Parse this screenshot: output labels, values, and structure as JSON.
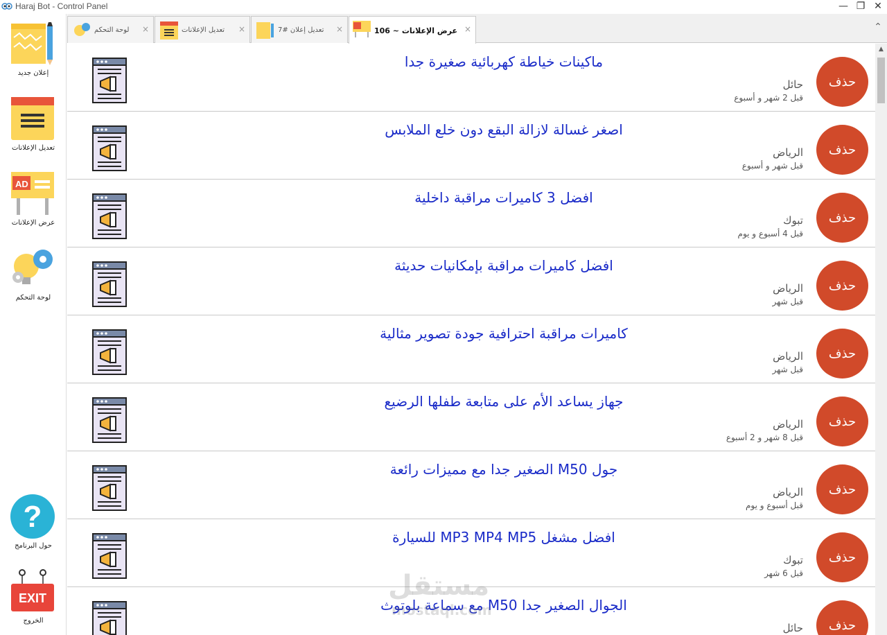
{
  "window": {
    "title": "Haraj Bot - Control Panel",
    "minimize": "—",
    "restore": "❐",
    "close": "✕",
    "chevron": "⌃"
  },
  "sidebar": {
    "new_ad": "إعلان جديد",
    "edit_ads": "تعديل الإعلانات",
    "view_ads": "عرض الإعلانات",
    "dashboard": "لوحة التحكم",
    "about": "حول البرنامج",
    "exit": "الخروج",
    "exit_sign": "EXIT",
    "ad_sign": "AD"
  },
  "tabs": [
    {
      "label": "لوحة التحكم",
      "close": "×"
    },
    {
      "label": "تعديل الإعلانات",
      "close": "×"
    },
    {
      "label": "تعديل إعلان #7",
      "close": "×"
    },
    {
      "label": "عرض الإعلانات ~ 106",
      "close": "×"
    }
  ],
  "delete_label": "حذف",
  "ads": [
    {
      "title": "ماكينات خياطة كهربائية صغيرة جدا",
      "city": "حائل",
      "time": "قبل 2 شهر و  أسبوع"
    },
    {
      "title": "اصغر غسالة لازالة البقع دون خلع الملابس",
      "city": "الرياض",
      "time": "قبل  شهر و  أسبوع"
    },
    {
      "title": "افضل 3 كاميرات مراقبة داخلية",
      "city": "تبوك",
      "time": "قبل 4 أسبوع و  يوم"
    },
    {
      "title": "افضل كاميرات مراقبة بإمكانيات حديثة",
      "city": "الرياض",
      "time": "قبل  شهر"
    },
    {
      "title": "كاميرات مراقبة احترافية جودة تصوير مثالية",
      "city": "الرياض",
      "time": "قبل  شهر"
    },
    {
      "title": "جهاز يساعد الأم على متابعة طفلها الرضيع",
      "city": "الرياض",
      "time": "قبل 8 شهر و 2 أسبوع"
    },
    {
      "title": "جول M50 الصغير جدا  مع مميزات رائعة",
      "city": "الرياض",
      "time": "قبل  أسبوع و  يوم"
    },
    {
      "title": "افضل مشغل MP3  MP4  MP5 للسيارة",
      "city": "تبوك",
      "time": "قبل 6 شهر"
    },
    {
      "title": "الجوال الصغير جدا M50 مع سماعة بلوتوث",
      "city": "حائل",
      "time": ""
    }
  ],
  "watermark": {
    "ar": "مستقل",
    "en": "mostaql.com"
  },
  "scroll_up": "▲"
}
